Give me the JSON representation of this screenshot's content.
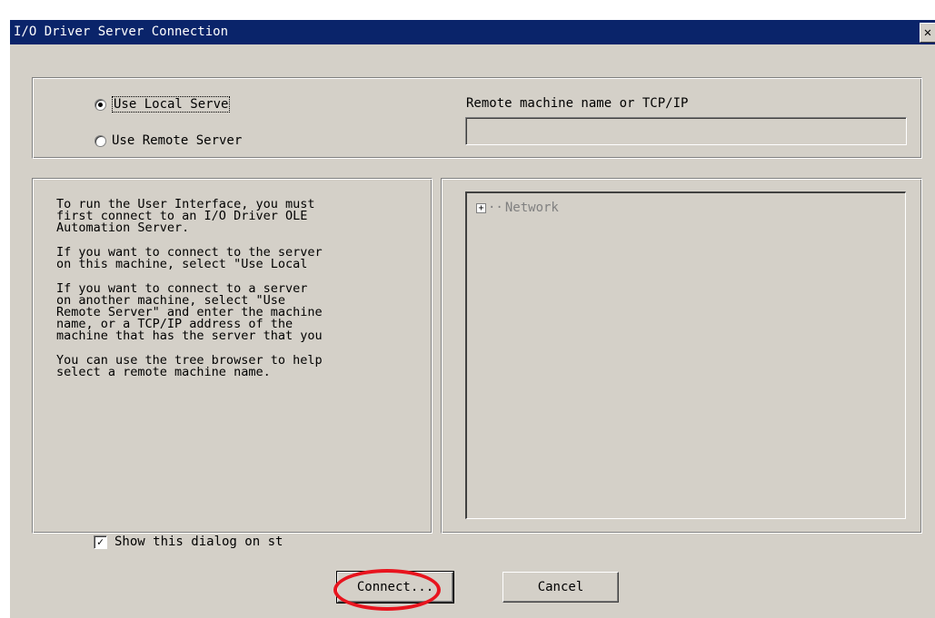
{
  "window": {
    "title": "I/O Driver Server Connection",
    "close_glyph": "✕"
  },
  "server_mode": {
    "local_label": "Use Local Serve",
    "remote_label": "Use Remote Server",
    "selected": "local"
  },
  "remote": {
    "label": "Remote machine name or TCP/IP",
    "value": ""
  },
  "help": {
    "paragraphs": [
      "To run the User Interface, you must\nfirst connect to an  I/O Driver OLE\nAutomation Server.",
      "If you want to connect to the server\non this machine, select \"Use Local",
      "If you want to connect to a server\non another machine, select \"Use\nRemote Server\" and enter the machine\nname, or a TCP/IP address of the\nmachine that has the server that you",
      "You can use the tree browser to help\nselect a remote machine name."
    ]
  },
  "tree": {
    "root_label": "Network",
    "expander": "+"
  },
  "options": {
    "show_dialog_label": "Show this dialog on st",
    "show_dialog_checked": true,
    "check_glyph": "✓"
  },
  "buttons": {
    "connect": "Connect...",
    "cancel": "Cancel"
  },
  "colors": {
    "titlebar": "#0a246a",
    "face": "#d4d0c8",
    "highlight_ring": "#e8141e"
  }
}
